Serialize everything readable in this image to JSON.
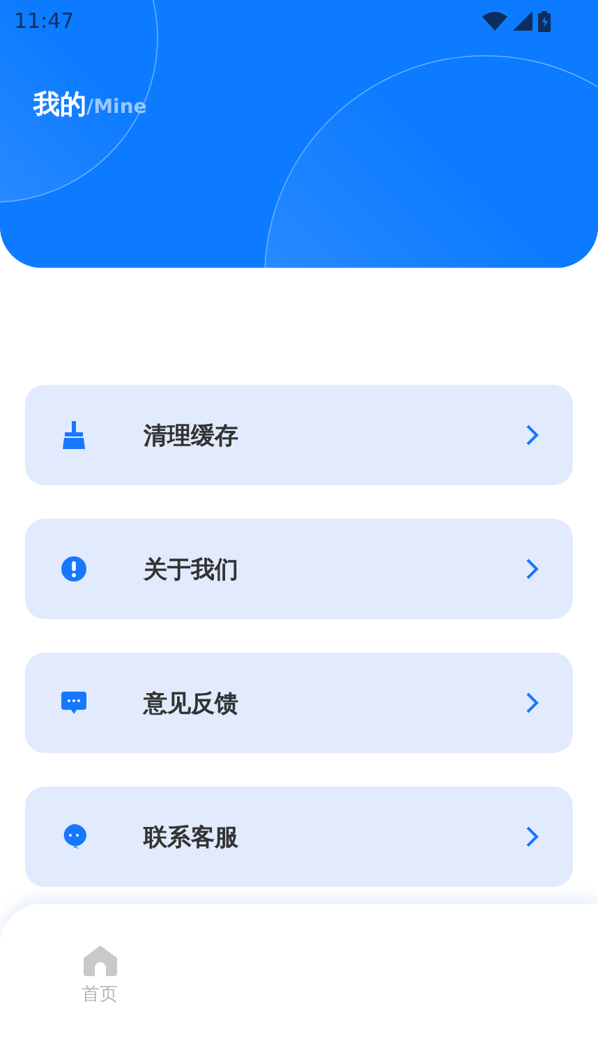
{
  "status_bar": {
    "time": "11:47"
  },
  "header": {
    "title": "我的",
    "subtitle": "/Mine"
  },
  "menu": [
    {
      "kind": "broom",
      "label": "清理缓存"
    },
    {
      "kind": "info",
      "label": "关于我们"
    },
    {
      "kind": "feedback",
      "label": "意见反馈"
    },
    {
      "kind": "service",
      "label": "联系客服"
    }
  ],
  "bottom_nav": [
    {
      "kind": "home",
      "label": "首页",
      "selected": false
    }
  ]
}
